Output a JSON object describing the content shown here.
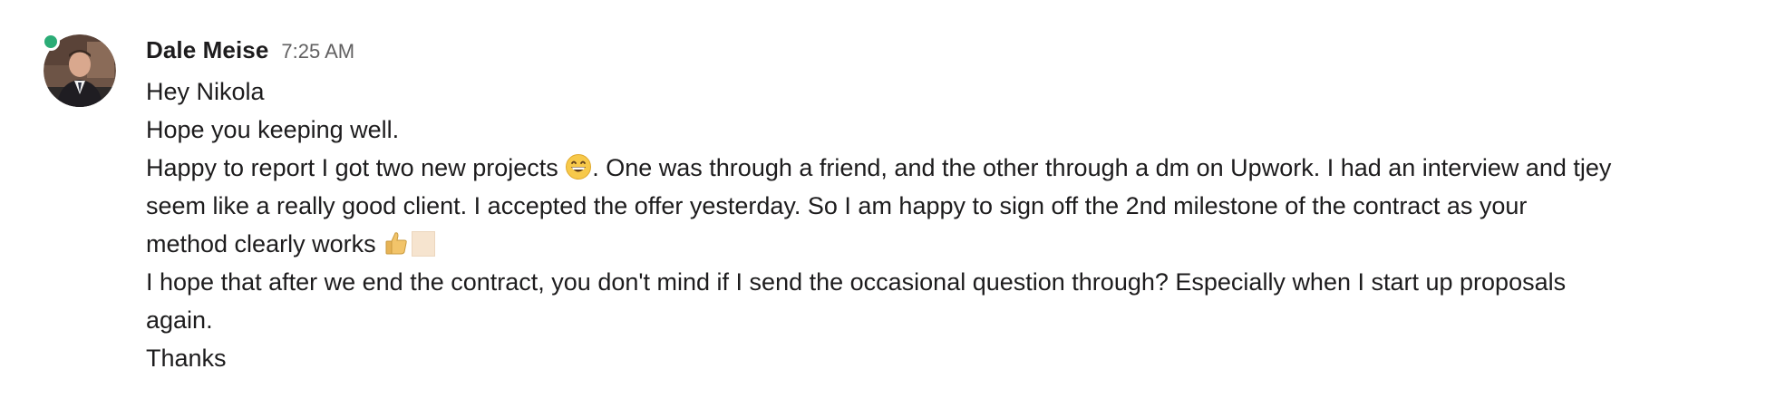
{
  "message": {
    "sender": "Dale Meise",
    "timestamp": "7:25 AM",
    "presence": "online",
    "colors": {
      "presence": "#2bac76",
      "text": "#1d1c1d",
      "timestamp": "#616061"
    },
    "lines": {
      "l1": "Hey Nikola",
      "l2": "Hope you keeping well.",
      "l3a": "Happy to report I got two new projects ",
      "l3b": ". One was through a friend, and the other through a dm on Upwork. I had an interview and tjey",
      "l4": "seem like a really good client. I accepted the offer yesterday. So I am happy to sign off the 2nd milestone of the contract as your",
      "l5": "method clearly works ",
      "l6": "I hope that after we end the contract, you don't mind if I send the occasional question through? Especially when I start up proposals",
      "l7": "again.",
      "l8": "Thanks"
    },
    "emojis": {
      "grin": "grinning-face-emoji",
      "thumbs": "thumbs-up-emoji"
    }
  }
}
